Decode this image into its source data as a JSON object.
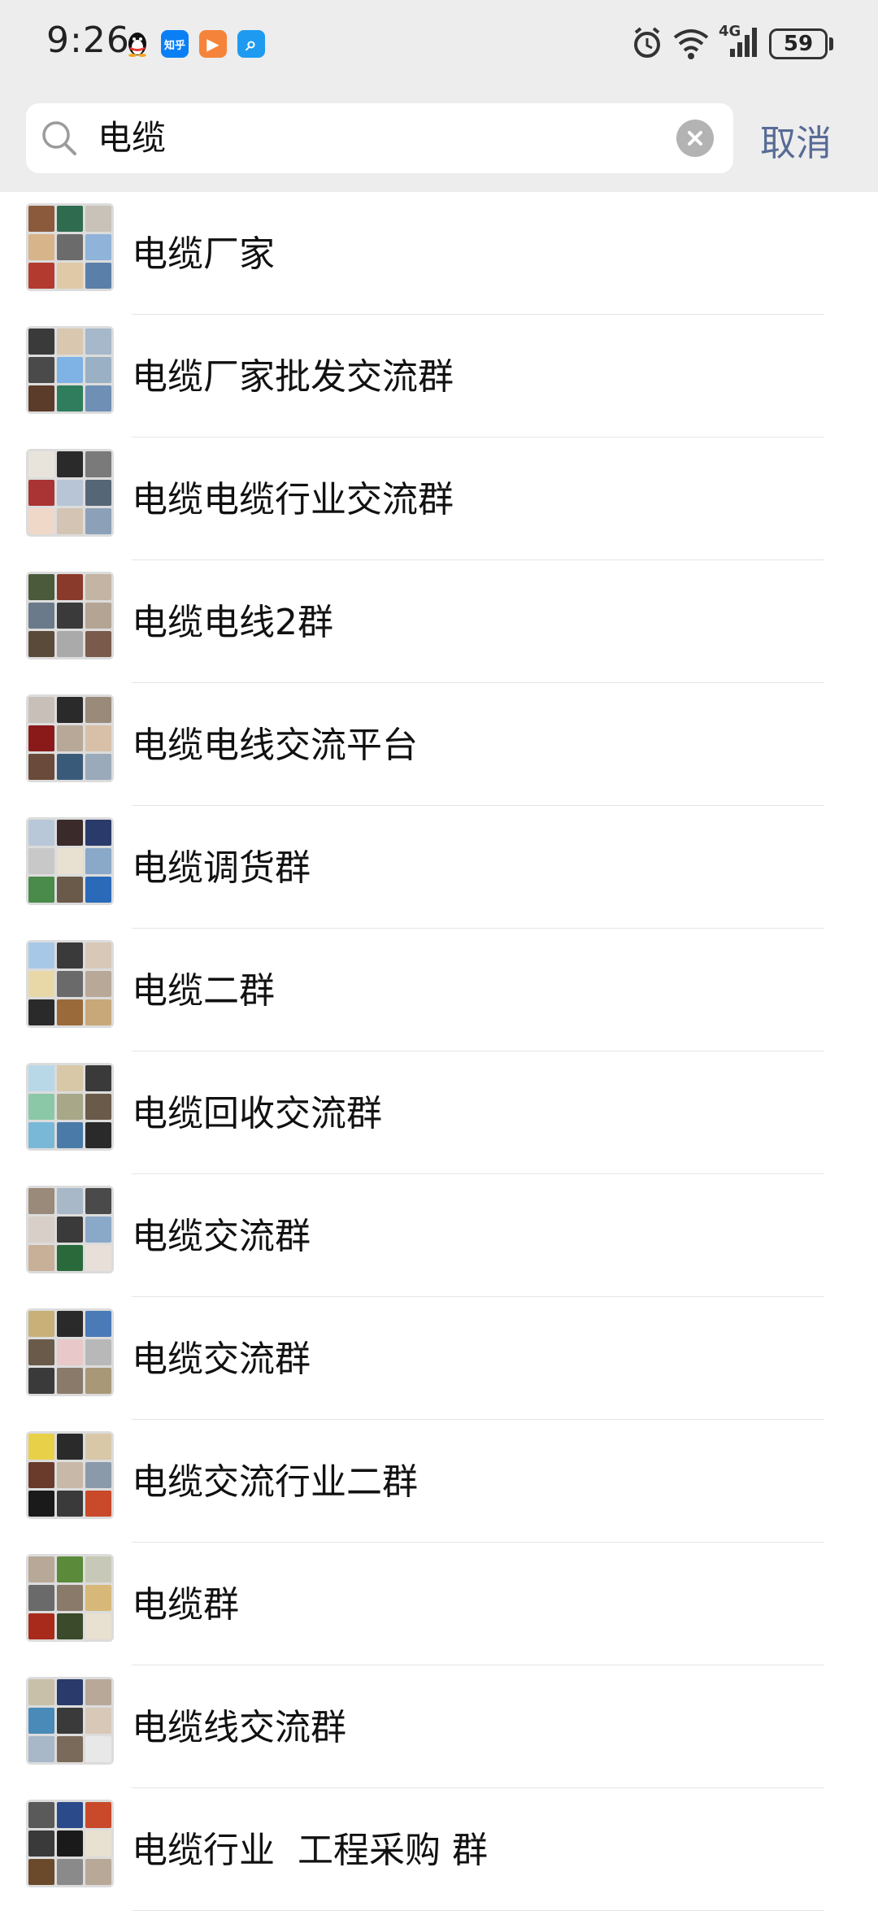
{
  "status_bar": {
    "time": "9:26",
    "apps": [
      {
        "icon": "qq-penguin-icon",
        "label": "",
        "color": "#ffffff"
      },
      {
        "icon": "zhihu-icon",
        "label": "知乎",
        "color": "#0a7ff5"
      },
      {
        "icon": "play-app-icon",
        "label": "▶",
        "color": "#f5843a"
      },
      {
        "icon": "search-app-icon",
        "label": "⌕",
        "color": "#1e9bf0"
      }
    ],
    "network": "4G",
    "battery": "59"
  },
  "search": {
    "query": "电缆",
    "cancel_label": "取消"
  },
  "results": [
    {
      "title": "电缆厂家"
    },
    {
      "title": "电缆厂家批发交流群"
    },
    {
      "title": "电缆电缆行业交流群"
    },
    {
      "title": "电缆电线2群"
    },
    {
      "title": "电缆电线交流平台"
    },
    {
      "title": "电缆调货群"
    },
    {
      "title": "电缆二群"
    },
    {
      "title": "电缆回收交流群"
    },
    {
      "title": "电缆交流群"
    },
    {
      "title": "电缆交流群"
    },
    {
      "title": "电缆交流行业二群"
    },
    {
      "title": "电缆群"
    },
    {
      "title": "电缆线交流群"
    },
    {
      "title": "电缆行业  工程采购 群"
    }
  ],
  "colors": {
    "header_bg": "#ededed",
    "cancel": "#576b95"
  }
}
